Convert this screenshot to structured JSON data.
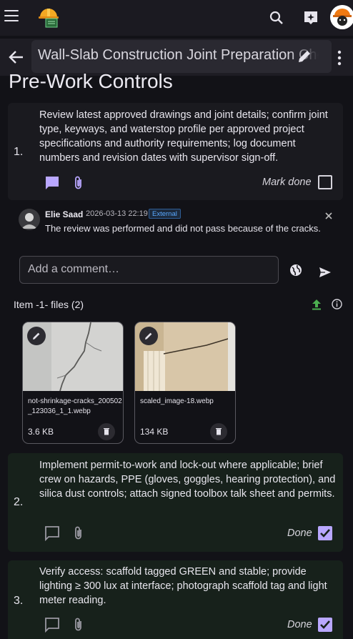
{
  "title": "Wall-Slab Construction Joint Preparation Checklist",
  "section_heading": "Pre-Work Controls",
  "items": [
    {
      "number": "1.",
      "text": "Review latest approved drawings and joint details; confirm joint type, keyways, and waterstop profile per approved project specifications and authority requirements; log document numbers and revision dates with supervisor sign-off.",
      "status_label": "Mark done",
      "done": false
    },
    {
      "number": "2.",
      "text": "Implement permit-to-work and lock-out where applicable; brief crew on hazards, PPE (gloves, goggles, hearing protection), and silica dust controls; attach signed toolbox talk sheet and permits.",
      "status_label": "Done",
      "done": true
    },
    {
      "number": "3.",
      "text": "Verify access: scaffold tagged GREEN and stable; provide lighting ≥ 300 lux at interface; photograph scaffold tag and light meter reading.",
      "status_label": "Done",
      "done": true
    }
  ],
  "comment": {
    "author": "Elie Saad",
    "date": "2026-03-13 22:19",
    "badge": "External",
    "text": "The review was performed and did not pass because of the cracks."
  },
  "comment_input": {
    "placeholder": "Add a comment…"
  },
  "files": {
    "label": "Item -1- files (2)",
    "list": [
      {
        "name": "not-shrinkage-cracks_200502_123036_1_1.webp",
        "size": "3.6 KB"
      },
      {
        "name": "scaled_image-18.webp",
        "size": "134 KB"
      }
    ]
  },
  "colors": {
    "accent": "#b9a7ff",
    "done_card": "#17211b",
    "card": "#1a1a1f",
    "background": "#121217",
    "upload": "#4caf50",
    "external_badge": "#5aa9ff"
  },
  "icons": [
    "menu-icon",
    "app-logo",
    "search-icon",
    "ai-sparkle-icon",
    "avatar",
    "back-arrow-icon",
    "edit-icon",
    "more-vert-icon",
    "comment-icon",
    "attach-icon",
    "close-icon",
    "globe-icon",
    "send-icon",
    "upload-icon",
    "info-icon",
    "delete-icon"
  ]
}
